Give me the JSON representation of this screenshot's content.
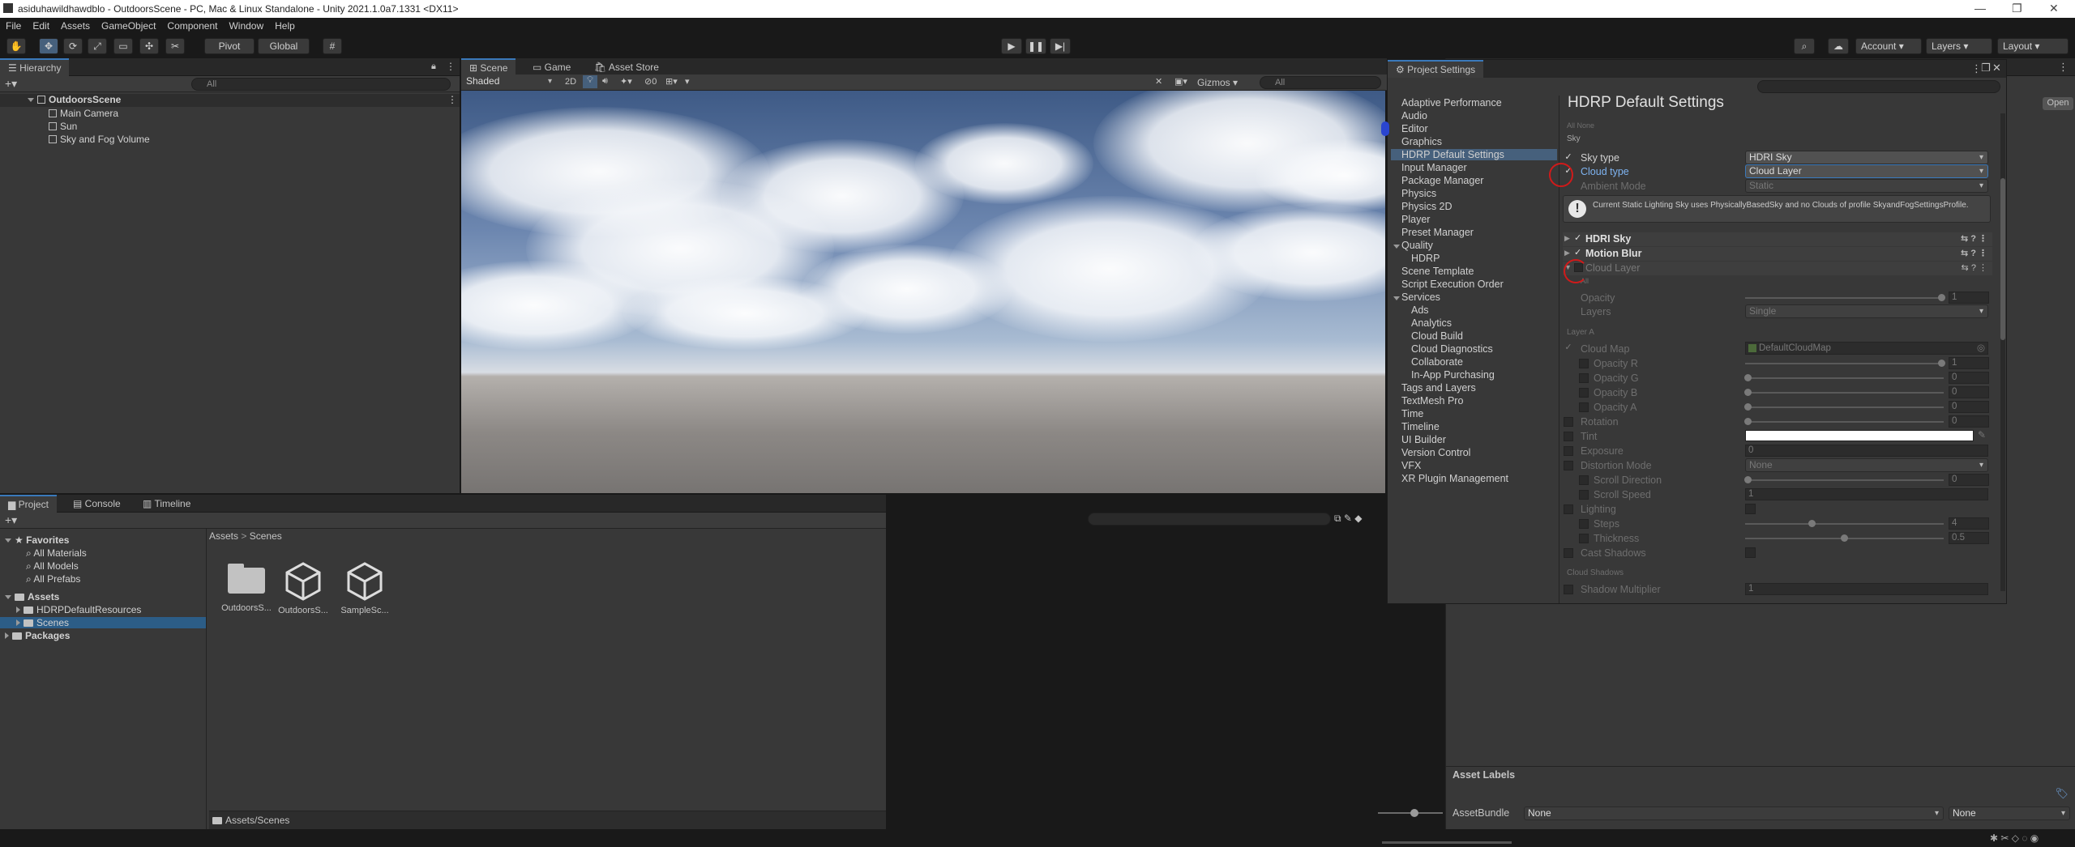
{
  "window": {
    "title": "asiduhawildhawdblo - OutdoorsScene - PC, Mac & Linux Standalone - Unity 2021.1.0a7.1331 <DX11>",
    "controls": [
      "—",
      "❐",
      "✕"
    ]
  },
  "menu": [
    "File",
    "Edit",
    "Assets",
    "GameObject",
    "Component",
    "Window",
    "Help"
  ],
  "toolbar": {
    "pivot": "Pivot",
    "global": "Global",
    "account": "Account",
    "layers": "Layers",
    "layout": "Layout"
  },
  "hierarchy": {
    "tab": "Hierarchy",
    "search_placeholder": "All",
    "scene": "OutdoorsScene",
    "items": [
      "Main Camera",
      "Sun",
      "Sky and Fog Volume"
    ]
  },
  "scene_tabs": [
    "Scene",
    "Game",
    "Asset Store"
  ],
  "scene_toolbar": {
    "shading": "Shaded",
    "mode2d": "2D",
    "fx_count": "0",
    "gizmos": "Gizmos",
    "search_placeholder": "All"
  },
  "project": {
    "tabs": [
      "Project",
      "Console",
      "Timeline"
    ],
    "favorites_label": "Favorites",
    "favorites": [
      "All Materials",
      "All Models",
      "All Prefabs"
    ],
    "assets_label": "Assets",
    "assets_children": [
      "HDRPDefaultResources",
      "Scenes"
    ],
    "packages_label": "Packages",
    "breadcrumb": [
      "Assets",
      "Scenes"
    ],
    "files": [
      "OutdoorsS...",
      "OutdoorsS...",
      "SampleSc..."
    ],
    "path": "Assets/Scenes"
  },
  "inspector_bottom": {
    "asset_labels": "Asset Labels",
    "assetbundle_label": "AssetBundle",
    "assetbundle_value": "None",
    "variant_value": "None",
    "open_button": "Open"
  },
  "project_settings": {
    "title": "Project Settings",
    "list": [
      "Adaptive Performance",
      "Audio",
      "Editor",
      "Graphics",
      "HDRP Default Settings",
      "Input Manager",
      "Package Manager",
      "Physics",
      "Physics 2D",
      "Player",
      "Preset Manager",
      "Quality",
      "HDRP",
      "Scene Template",
      "Script Execution Order",
      "Services",
      "Ads",
      "Analytics",
      "Cloud Build",
      "Cloud Diagnostics",
      "Collaborate",
      "In-App Purchasing",
      "Tags and Layers",
      "TextMesh Pro",
      "Time",
      "Timeline",
      "UI Builder",
      "Version Control",
      "VFX",
      "XR Plugin Management"
    ],
    "selected": "HDRP Default Settings",
    "heading": "HDRP Default Settings",
    "all_none": "All  None",
    "sky_section": "Sky",
    "sky_type_label": "Sky type",
    "sky_type_value": "HDRI Sky",
    "cloud_type_label": "Cloud type",
    "cloud_type_value": "Cloud Layer",
    "ambient_mode_label": "Ambient Mode",
    "ambient_mode_value": "Static",
    "warning": "Current Static Lighting Sky uses PhysicallyBasedSky and no Clouds of profile SkyandFogSettingsProfile.",
    "components": [
      "HDRI Sky",
      "Motion Blur",
      "Cloud Layer"
    ],
    "cloud_layer": {
      "all_label": "All",
      "opacity_label": "Opacity",
      "opacity_value": "1",
      "layers_label": "Layers",
      "layers_value": "Single",
      "layer_a": "Layer A",
      "cloud_map_label": "Cloud Map",
      "cloud_map_value": "DefaultCloudMap",
      "opacity_r_label": "Opacity R",
      "opacity_r_value": "1",
      "opacity_g_label": "Opacity G",
      "opacity_g_value": "0",
      "opacity_b_label": "Opacity B",
      "opacity_b_value": "0",
      "opacity_a_label": "Opacity A",
      "opacity_a_value": "0",
      "rotation_label": "Rotation",
      "rotation_value": "0",
      "tint_label": "Tint",
      "exposure_label": "Exposure",
      "exposure_value": "0",
      "distortion_label": "Distortion Mode",
      "distortion_value": "None",
      "scroll_dir_label": "Scroll Direction",
      "scroll_dir_value": "0",
      "scroll_speed_label": "Scroll Speed",
      "scroll_speed_value": "1",
      "lighting_label": "Lighting",
      "steps_label": "Steps",
      "steps_value": "4",
      "thickness_label": "Thickness",
      "thickness_value": "0.5",
      "cast_shadows_label": "Cast Shadows",
      "cloud_shadows": "Cloud Shadows",
      "shadow_mult_label": "Shadow Multiplier",
      "shadow_mult_value": "1"
    }
  }
}
